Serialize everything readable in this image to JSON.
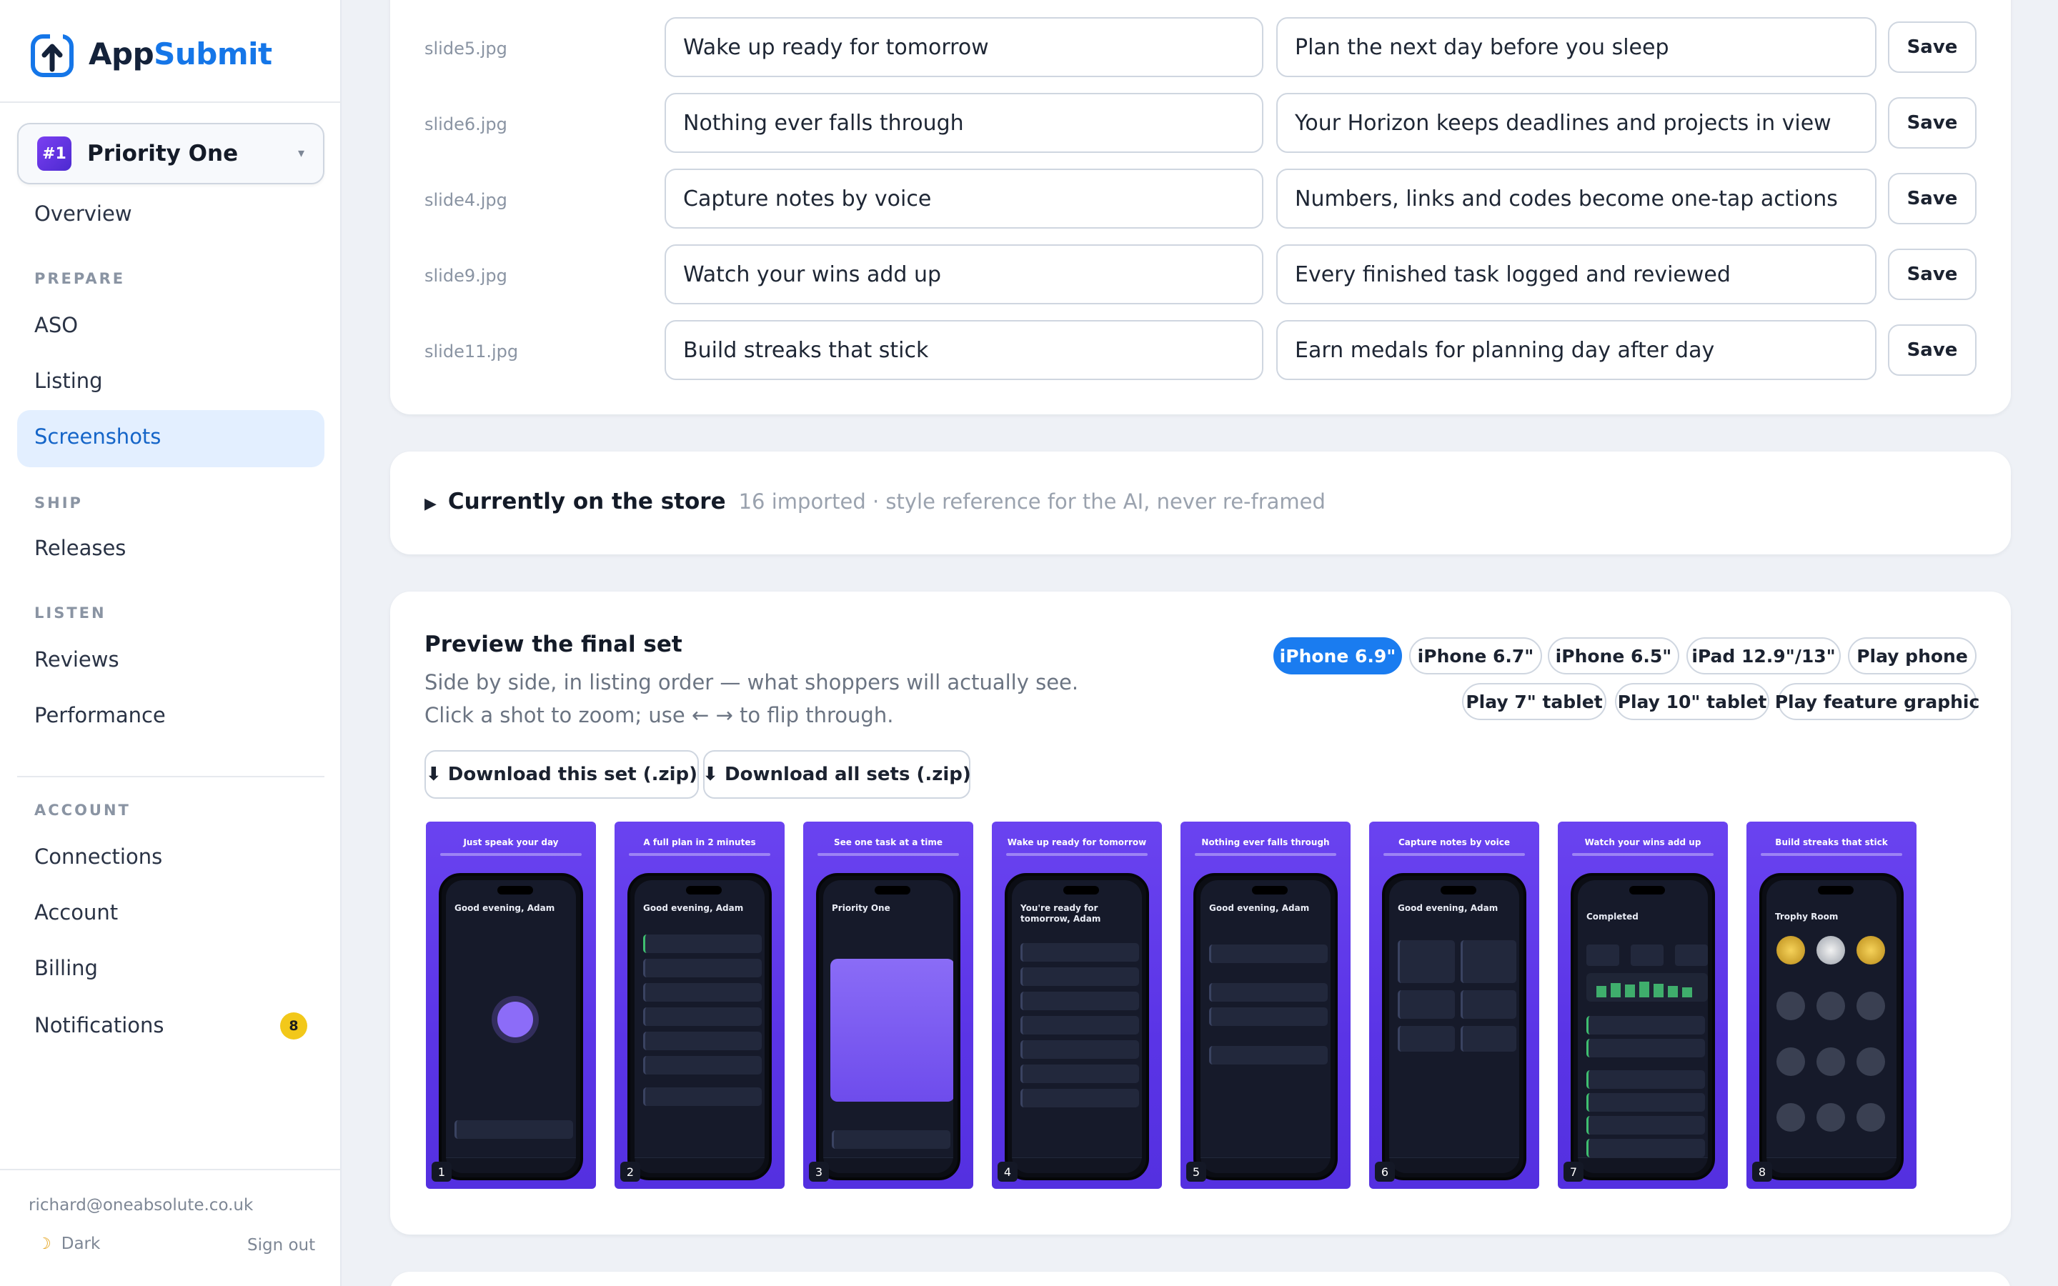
{
  "brand": {
    "name_part1": "App",
    "name_part2": "Submit"
  },
  "app_picker": {
    "badge": "#1",
    "name": "Priority One",
    "caret": "▾"
  },
  "nav": {
    "overview": "Overview",
    "prepare_section": "PREPARE",
    "aso": "ASO",
    "listing": "Listing",
    "screenshots": "Screenshots",
    "ship_section": "SHIP",
    "releases": "Releases",
    "listen_section": "LISTEN",
    "reviews": "Reviews",
    "performance": "Performance",
    "account_section": "ACCOUNT",
    "connections": "Connections",
    "account": "Account",
    "billing": "Billing",
    "notifications": "Notifications",
    "notifications_count": "8"
  },
  "footer": {
    "email": "richard@oneabsolute.co.uk",
    "theme_icon": "☽",
    "theme_label": "Dark",
    "sign_out": "Sign out"
  },
  "slides": [
    {
      "file": "slide5.jpg",
      "headline": "Wake up ready for tomorrow",
      "subtitle": "Plan the next day before you sleep",
      "save": "Save"
    },
    {
      "file": "slide6.jpg",
      "headline": "Nothing ever falls through",
      "subtitle": "Your Horizon keeps deadlines and projects in view",
      "save": "Save"
    },
    {
      "file": "slide4.jpg",
      "headline": "Capture notes by voice",
      "subtitle": "Numbers, links and codes become one-tap actions",
      "save": "Save"
    },
    {
      "file": "slide9.jpg",
      "headline": "Watch your wins add up",
      "subtitle": "Every finished task logged and reviewed",
      "save": "Save"
    },
    {
      "file": "slide11.jpg",
      "headline": "Build streaks that stick",
      "subtitle": "Earn medals for planning day after day",
      "save": "Save"
    }
  ],
  "store": {
    "toggle_icon": "▶",
    "title": "Currently on the store",
    "meta": "16 imported · style reference for the AI, never re-framed"
  },
  "preview": {
    "title": "Preview the final set",
    "description": "Side by side, in listing order — what shoppers will actually see. Click a shot to zoom; use ← → to flip through.",
    "download_set": "⬇ Download this set (.zip)",
    "download_all": "⬇ Download all sets (.zip)",
    "devices": [
      "iPhone 6.9\"",
      "iPhone 6.7\"",
      "iPhone 6.5\"",
      "iPad 12.9\"/13\"",
      "Play phone",
      "Play 7\" tablet",
      "Play 10\" tablet",
      "Play feature graphic"
    ],
    "active_device": "iPhone 6.9\"",
    "accent_color": "#1a7cf0",
    "shots": [
      {
        "num": "1",
        "headline": "Just speak your day",
        "screen_title": "Good evening, Adam"
      },
      {
        "num": "2",
        "headline": "A full plan in 2 minutes",
        "screen_title": "Good evening, Adam"
      },
      {
        "num": "3",
        "headline": "See one task at a time",
        "screen_title": "Priority One"
      },
      {
        "num": "4",
        "headline": "Wake up ready for tomorrow",
        "screen_title": "You're ready for tomorrow, Adam"
      },
      {
        "num": "5",
        "headline": "Nothing ever falls through",
        "screen_title": "Good evening, Adam"
      },
      {
        "num": "6",
        "headline": "Capture notes by voice",
        "screen_title": "Good evening, Adam"
      },
      {
        "num": "7",
        "headline": "Watch your wins add up",
        "screen_title": "Completed"
      },
      {
        "num": "8",
        "headline": "Build streaks that stick",
        "screen_title": "Trophy Room"
      }
    ]
  }
}
